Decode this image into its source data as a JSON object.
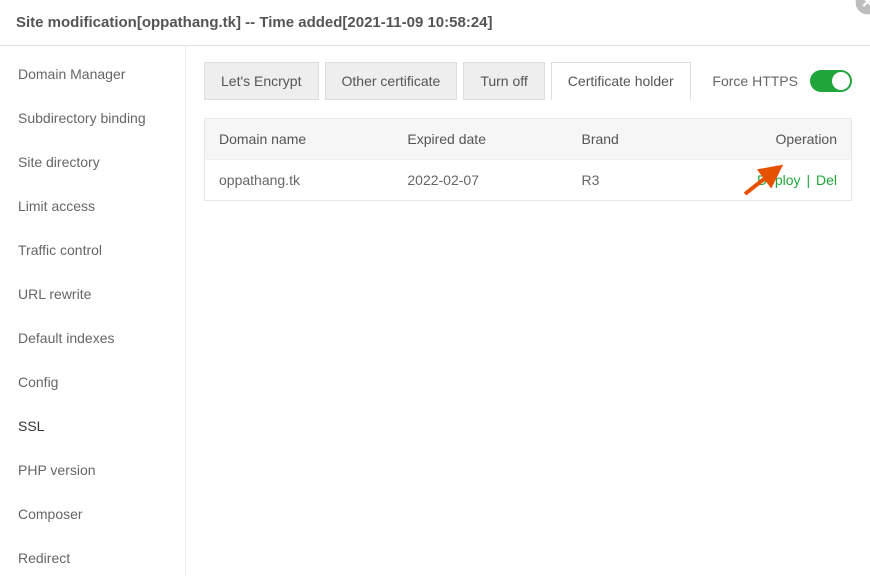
{
  "header": {
    "title": "Site modification[oppathang.tk] -- Time added[2021-11-09 10:58:24]"
  },
  "sidebar": {
    "items": [
      {
        "label": "Domain Manager"
      },
      {
        "label": "Subdirectory binding"
      },
      {
        "label": "Site directory"
      },
      {
        "label": "Limit access"
      },
      {
        "label": "Traffic control"
      },
      {
        "label": "URL rewrite"
      },
      {
        "label": "Default indexes"
      },
      {
        "label": "Config"
      },
      {
        "label": "SSL"
      },
      {
        "label": "PHP version"
      },
      {
        "label": "Composer"
      },
      {
        "label": "Redirect"
      }
    ],
    "activeIndex": 8
  },
  "tabs": {
    "items": [
      {
        "label": "Let's Encrypt"
      },
      {
        "label": "Other certificate"
      },
      {
        "label": "Turn off"
      },
      {
        "label": "Certificate holder"
      }
    ],
    "activeIndex": 3
  },
  "forceHttps": {
    "label": "Force HTTPS",
    "enabled": true
  },
  "table": {
    "headers": [
      "Domain name",
      "Expired date",
      "Brand",
      "Operation"
    ],
    "rows": [
      {
        "domain": "oppathang.tk",
        "expired": "2022-02-07",
        "brand": "R3",
        "actions": {
          "deploy": "Deploy",
          "del": "Del"
        }
      }
    ]
  }
}
